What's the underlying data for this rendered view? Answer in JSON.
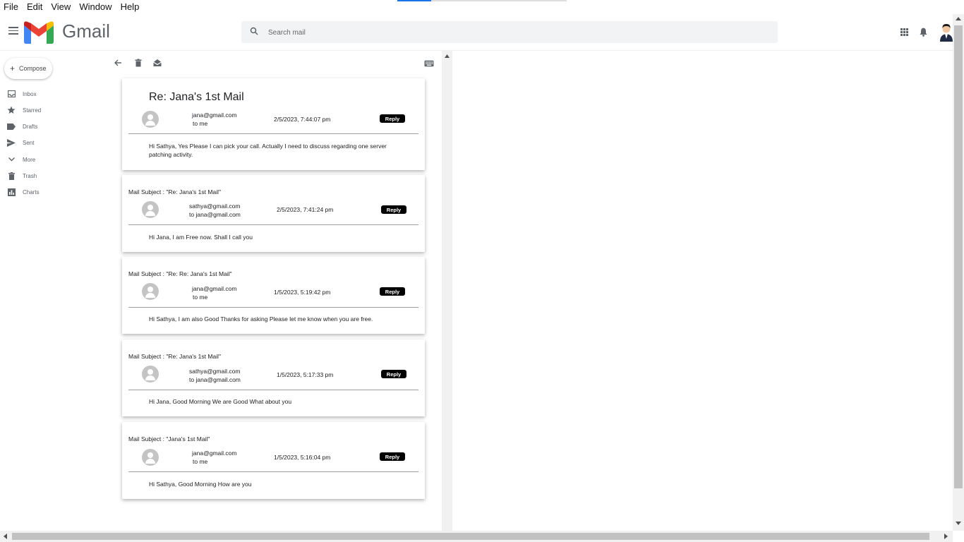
{
  "menu": [
    "File",
    "Edit",
    "View",
    "Window",
    "Help"
  ],
  "app": {
    "name": "Gmail"
  },
  "search": {
    "placeholder": "Search mail"
  },
  "sidebar": {
    "compose_label": "Compose",
    "items": [
      {
        "label": "Inbox",
        "icon": "inbox-icon"
      },
      {
        "label": "Starred",
        "icon": "star-icon"
      },
      {
        "label": "Drafts",
        "icon": "label-icon"
      },
      {
        "label": "Sent",
        "icon": "send-icon"
      },
      {
        "label": "More",
        "icon": "chevron-down-icon"
      },
      {
        "label": "Trash",
        "icon": "trash-icon"
      },
      {
        "label": "Charts",
        "icon": "chart-icon"
      }
    ]
  },
  "thread": {
    "title": "Re: Jana's 1st Mail",
    "messages": [
      {
        "from": "jana@gmail.com",
        "to": "to me",
        "date": "2/5/2023, 7:44:07 pm",
        "reply_label": "Reply",
        "body": "Hi Sathya, Yes Please I can pick your call. Actually I need to discuss regarding one server patching activity."
      },
      {
        "subject": "Mail Subject : \"Re: Jana's 1st Mail\"",
        "from": "sathya@gmail.com",
        "to": "to jana@gmail.com",
        "date": "2/5/2023, 7:41:24 pm",
        "reply_label": "Reply",
        "body": "Hi Jana, I am Free now. Shall I call you"
      },
      {
        "subject": "Mail Subject : \"Re: Re: Jana's 1st Mail\"",
        "from": "jana@gmail.com",
        "to": "to me",
        "date": "1/5/2023, 5:19:42 pm",
        "reply_label": "Reply",
        "body": "Hi Sathya, I am also Good Thanks for asking Please let me know when you are free."
      },
      {
        "subject": "Mail Subject : \"Re: Jana's 1st Mail\"",
        "from": "sathya@gmail.com",
        "to": "to jana@gmail.com",
        "date": "1/5/2023, 5:17:33 pm",
        "reply_label": "Reply",
        "body": "Hi Jana, Good Morning We are Good What about you"
      },
      {
        "subject": "Mail Subject : \"Jana's 1st Mail\"",
        "from": "jana@gmail.com",
        "to": "to me",
        "date": "1/5/2023, 5:16:04 pm",
        "reply_label": "Reply",
        "body": "Hi Sathya, Good Morning How are you"
      }
    ]
  },
  "colors": {
    "gmail_red": "#ea4335",
    "gmail_blue": "#4285f4",
    "gmail_green": "#34a853",
    "gmail_yellow": "#fbbc04",
    "reply_bg": "#000000"
  }
}
